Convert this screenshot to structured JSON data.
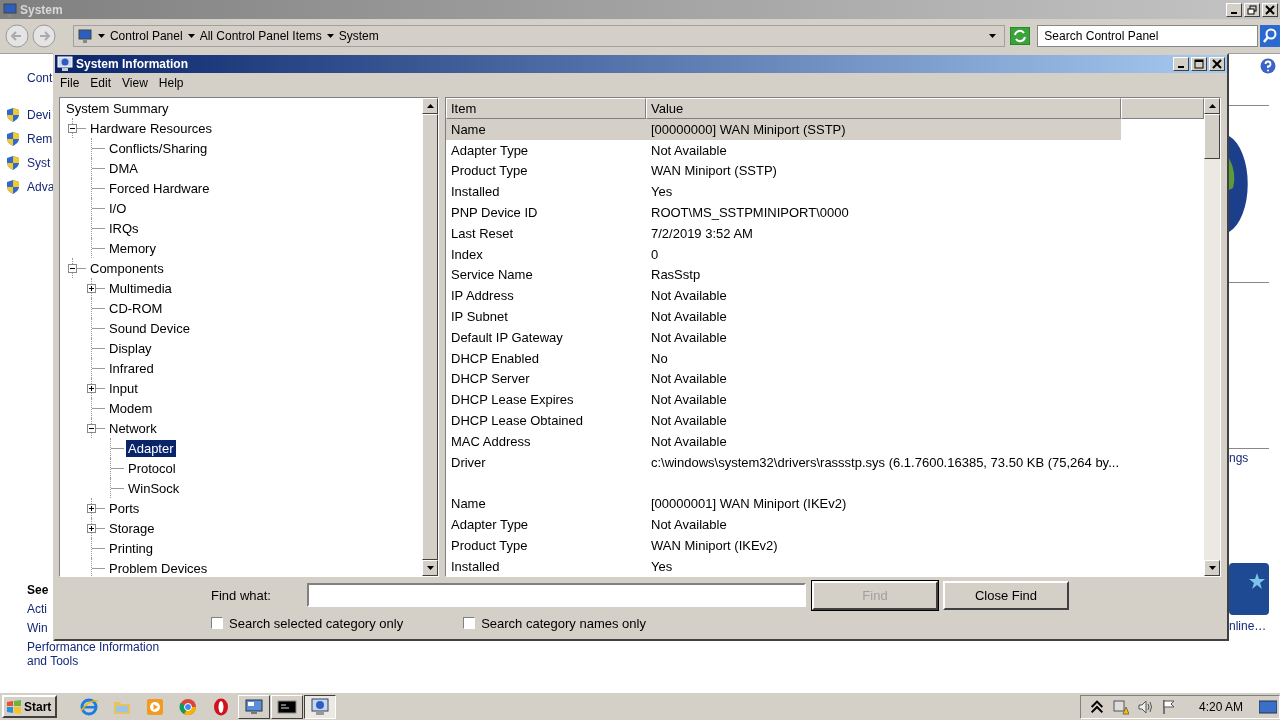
{
  "background_window": {
    "title": "System",
    "breadcrumb": [
      "Control Panel",
      "All Control Panel Items",
      "System"
    ],
    "search": {
      "placeholder": "Search Control Panel"
    },
    "home_link": "Cont",
    "tasks": [
      "Devi",
      "Rem",
      "Syst",
      "Adva"
    ],
    "see_also": {
      "heading": "See",
      "links": [
        "Acti",
        "Win",
        "Performance Information and Tools"
      ]
    },
    "right_texts": [
      "ngs",
      "nline…"
    ]
  },
  "dialog": {
    "title": "System Information",
    "menu": [
      "File",
      "Edit",
      "View",
      "Help"
    ],
    "tree": [
      {
        "label": "System Summary",
        "selected": false,
        "children": [
          {
            "label": "Hardware Resources",
            "expanded": true,
            "selected": false,
            "children": [
              {
                "label": "Conflicts/Sharing",
                "selected": false
              },
              {
                "label": "DMA",
                "selected": false
              },
              {
                "label": "Forced Hardware",
                "selected": false
              },
              {
                "label": "I/O",
                "selected": false
              },
              {
                "label": "IRQs",
                "selected": false
              },
              {
                "label": "Memory",
                "selected": false
              }
            ]
          },
          {
            "label": "Components",
            "expanded": true,
            "selected": false,
            "children": [
              {
                "label": "Multimedia",
                "expanded": false,
                "selected": false
              },
              {
                "label": "CD-ROM",
                "selected": false
              },
              {
                "label": "Sound Device",
                "selected": false
              },
              {
                "label": "Display",
                "selected": false
              },
              {
                "label": "Infrared",
                "selected": false
              },
              {
                "label": "Input",
                "expanded": false,
                "selected": false
              },
              {
                "label": "Modem",
                "selected": false
              },
              {
                "label": "Network",
                "expanded": true,
                "selected": false,
                "children": [
                  {
                    "label": "Adapter",
                    "selected": true
                  },
                  {
                    "label": "Protocol",
                    "selected": false
                  },
                  {
                    "label": "WinSock",
                    "selected": false
                  }
                ]
              },
              {
                "label": "Ports",
                "expanded": false,
                "selected": false
              },
              {
                "label": "Storage",
                "expanded": false,
                "selected": false
              },
              {
                "label": "Printing",
                "selected": false
              },
              {
                "label": "Problem Devices",
                "selected": false
              }
            ]
          }
        ]
      }
    ],
    "table": {
      "columns": [
        "Item",
        "Value"
      ],
      "rows": [
        {
          "kind": "entry",
          "item": "Name",
          "value": "[00000000] WAN Miniport (SSTP)",
          "selected": true
        },
        {
          "kind": "entry",
          "item": "Adapter Type",
          "value": "Not Available",
          "selected": false
        },
        {
          "kind": "entry",
          "item": "Product Type",
          "value": "WAN Miniport (SSTP)",
          "selected": false
        },
        {
          "kind": "entry",
          "item": "Installed",
          "value": "Yes",
          "selected": false
        },
        {
          "kind": "entry",
          "item": "PNP Device ID",
          "value": "ROOT\\MS_SSTPMINIPORT\\0000",
          "selected": false
        },
        {
          "kind": "entry",
          "item": "Last Reset",
          "value": "7/2/2019 3:52 AM",
          "selected": false
        },
        {
          "kind": "entry",
          "item": "Index",
          "value": "0",
          "selected": false
        },
        {
          "kind": "entry",
          "item": "Service Name",
          "value": "RasSstp",
          "selected": false
        },
        {
          "kind": "entry",
          "item": "IP Address",
          "value": "Not Available",
          "selected": false
        },
        {
          "kind": "entry",
          "item": "IP Subnet",
          "value": "Not Available",
          "selected": false
        },
        {
          "kind": "entry",
          "item": "Default IP Gateway",
          "value": "Not Available",
          "selected": false
        },
        {
          "kind": "entry",
          "item": "DHCP Enabled",
          "value": "No",
          "selected": false
        },
        {
          "kind": "entry",
          "item": "DHCP Server",
          "value": "Not Available",
          "selected": false
        },
        {
          "kind": "entry",
          "item": "DHCP Lease Expires",
          "value": "Not Available",
          "selected": false
        },
        {
          "kind": "entry",
          "item": "DHCP Lease Obtained",
          "value": "Not Available",
          "selected": false
        },
        {
          "kind": "entry",
          "item": "MAC Address",
          "value": "Not Available",
          "selected": false
        },
        {
          "kind": "entry",
          "item": "Driver",
          "value": "c:\\windows\\system32\\drivers\\rassstp.sys (6.1.7600.16385, 73.50 KB (75,264 by...",
          "selected": false
        },
        {
          "kind": "blank"
        },
        {
          "kind": "entry",
          "item": "Name",
          "value": "[00000001] WAN Miniport (IKEv2)",
          "selected": false
        },
        {
          "kind": "entry",
          "item": "Adapter Type",
          "value": "Not Available",
          "selected": false
        },
        {
          "kind": "entry",
          "item": "Product Type",
          "value": "WAN Miniport (IKEv2)",
          "selected": false
        },
        {
          "kind": "entry",
          "item": "Installed",
          "value": "Yes",
          "selected": false
        }
      ]
    },
    "find": {
      "label": "Find what:",
      "buttons": [
        {
          "label": "Find",
          "disabled": true
        },
        {
          "label": "Close Find",
          "disabled": false
        }
      ],
      "checkboxes": [
        {
          "label": "Search selected category only",
          "checked": false
        },
        {
          "label": "Search category names only",
          "checked": false
        }
      ]
    }
  },
  "taskbar": {
    "start": "Start",
    "apps": [
      {
        "kind": "browser-e",
        "running": false,
        "selected": false
      },
      {
        "kind": "folder",
        "running": false,
        "selected": false
      },
      {
        "kind": "media",
        "running": false,
        "selected": false
      },
      {
        "kind": "browser-c",
        "running": false,
        "selected": false
      },
      {
        "kind": "browser-o",
        "running": false,
        "selected": false
      },
      {
        "kind": "monitor",
        "running": true,
        "selected": false
      },
      {
        "kind": "console",
        "running": true,
        "selected": false
      },
      {
        "kind": "info",
        "running": true,
        "selected": true
      }
    ],
    "clock": "4:20 AM"
  }
}
